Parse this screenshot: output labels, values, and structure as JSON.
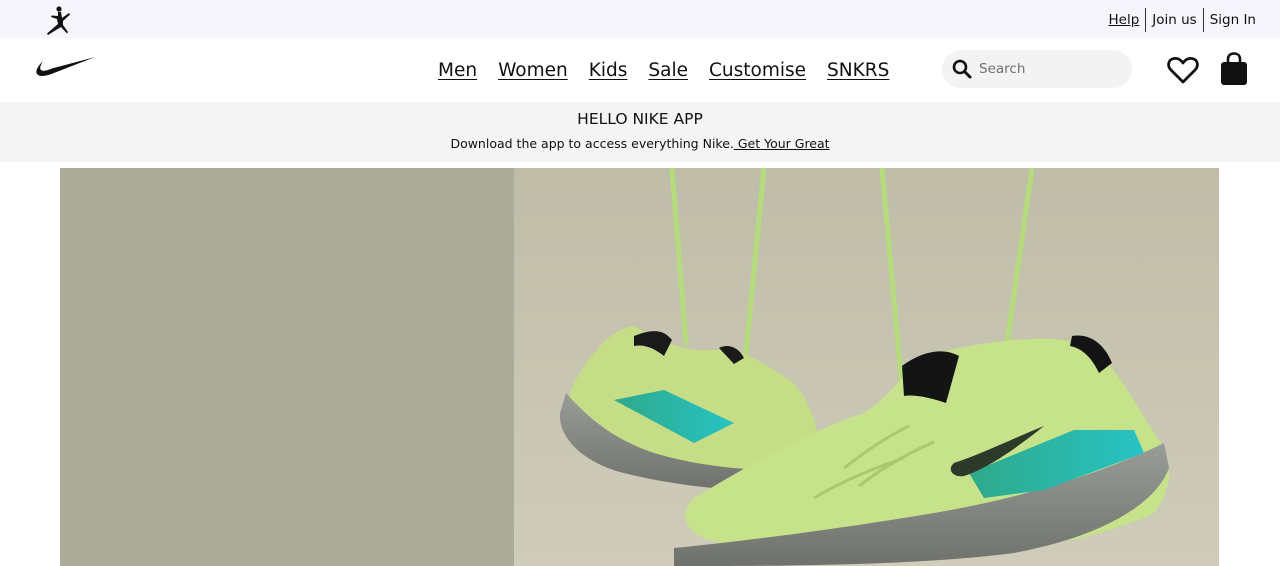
{
  "utility_bar": {
    "help": "Help",
    "join_us": "Join us",
    "sign_in": "Sign In"
  },
  "nav": {
    "items": [
      "Men",
      "Women",
      "Kids",
      "Sale",
      "Customise",
      "SNKRS"
    ]
  },
  "search": {
    "placeholder": "Search"
  },
  "promo": {
    "title": "HELLO NIKE APP",
    "text": "Download the app to access everything Nike.",
    "link": " Get Your Great"
  },
  "icons": {
    "jordan_logo": "jumpman-logo-icon",
    "brand_logo": "swoosh-logo-icon",
    "search": "search-icon",
    "favourites": "heart-icon",
    "bag": "shopping-bag-icon"
  },
  "colors": {
    "utility_bar_bg": "#f5f5fb",
    "promo_bg": "#f4f4f4",
    "search_bg": "#f3f3f3",
    "hero_left_bg": "#adab99",
    "hero_right_bg": "#c9c8b3",
    "shoe_green": "#c6e28a",
    "shoe_teal": "#1fb4b0"
  }
}
